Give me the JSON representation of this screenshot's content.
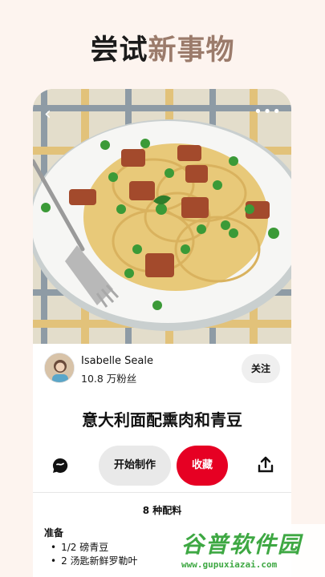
{
  "headline": {
    "part1": "尝试",
    "part2": "新事物"
  },
  "pin": {
    "author": {
      "name": "Isabelle Seale",
      "followers": "10.8 万粉丝",
      "follow_label": "关注"
    },
    "title": "意大利面配熏肉和青豆",
    "actions": {
      "start_label": "开始制作",
      "save_label": "收藏"
    },
    "ingredients": {
      "count_label": "8 种配料",
      "section": "准备",
      "items": [
        "1/2 磅青豆",
        "2 汤匙新鲜罗勒叶"
      ]
    }
  },
  "watermark": {
    "title": "谷普软件园",
    "url": "www.gupuxiazai.com"
  },
  "colors": {
    "save": "#e60023",
    "background": "#fdf4ef",
    "headline_accent": "#9b7b6b",
    "watermark": "#3ea843"
  },
  "icons": [
    "back-arrow-icon",
    "more-icon",
    "comment-icon",
    "share-icon"
  ]
}
